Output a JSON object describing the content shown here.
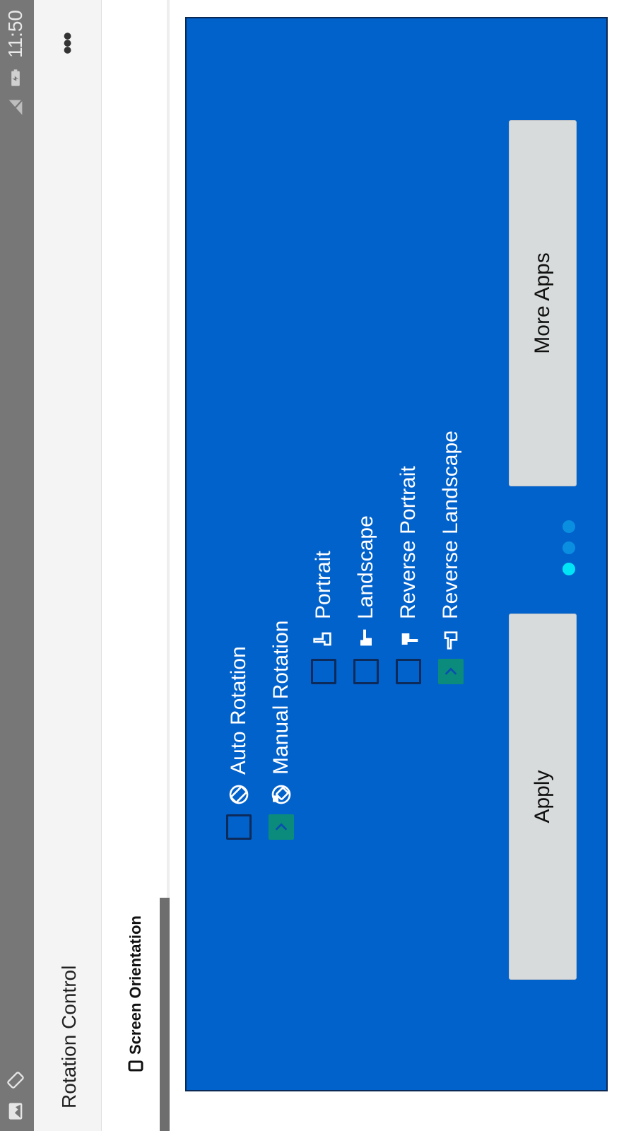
{
  "status_bar": {
    "time": "11:50",
    "icons": [
      "gallery-icon",
      "rotation-icon",
      "no-sim-icon",
      "battery-charging-icon"
    ]
  },
  "app_bar": {
    "title": "Rotation Control",
    "overflow_icon": "more-horizontal-icon"
  },
  "tabs": [
    {
      "label": "Screen Orientation",
      "icon": "phone-outline-icon",
      "active": true
    }
  ],
  "options": {
    "auto_rotation": {
      "label": "Auto Rotation",
      "checked": false,
      "icon": "auto-rotate-icon"
    },
    "manual_rotation": {
      "label": "Manual Rotation",
      "checked": true,
      "icon": "rotation-lock-icon"
    },
    "orientations": [
      {
        "label": "Portrait",
        "checked": false,
        "icon": "hand-point-up-icon"
      },
      {
        "label": "Landscape",
        "checked": false,
        "icon": "hand-point-right-icon"
      },
      {
        "label": "Reverse Portrait",
        "checked": false,
        "icon": "hand-point-down-icon"
      },
      {
        "label": "Reverse Landscape",
        "checked": true,
        "icon": "hand-point-left-icon"
      }
    ]
  },
  "buttons": {
    "apply": "Apply",
    "more_apps": "More Apps"
  },
  "pager": {
    "count": 3,
    "active_index": 0
  },
  "colors": {
    "panel": "#0262cc",
    "checked": "#0b8b7b",
    "dot_active": "#00e5f6",
    "dot": "#0a8ee0",
    "button": "#d8dbdb"
  }
}
